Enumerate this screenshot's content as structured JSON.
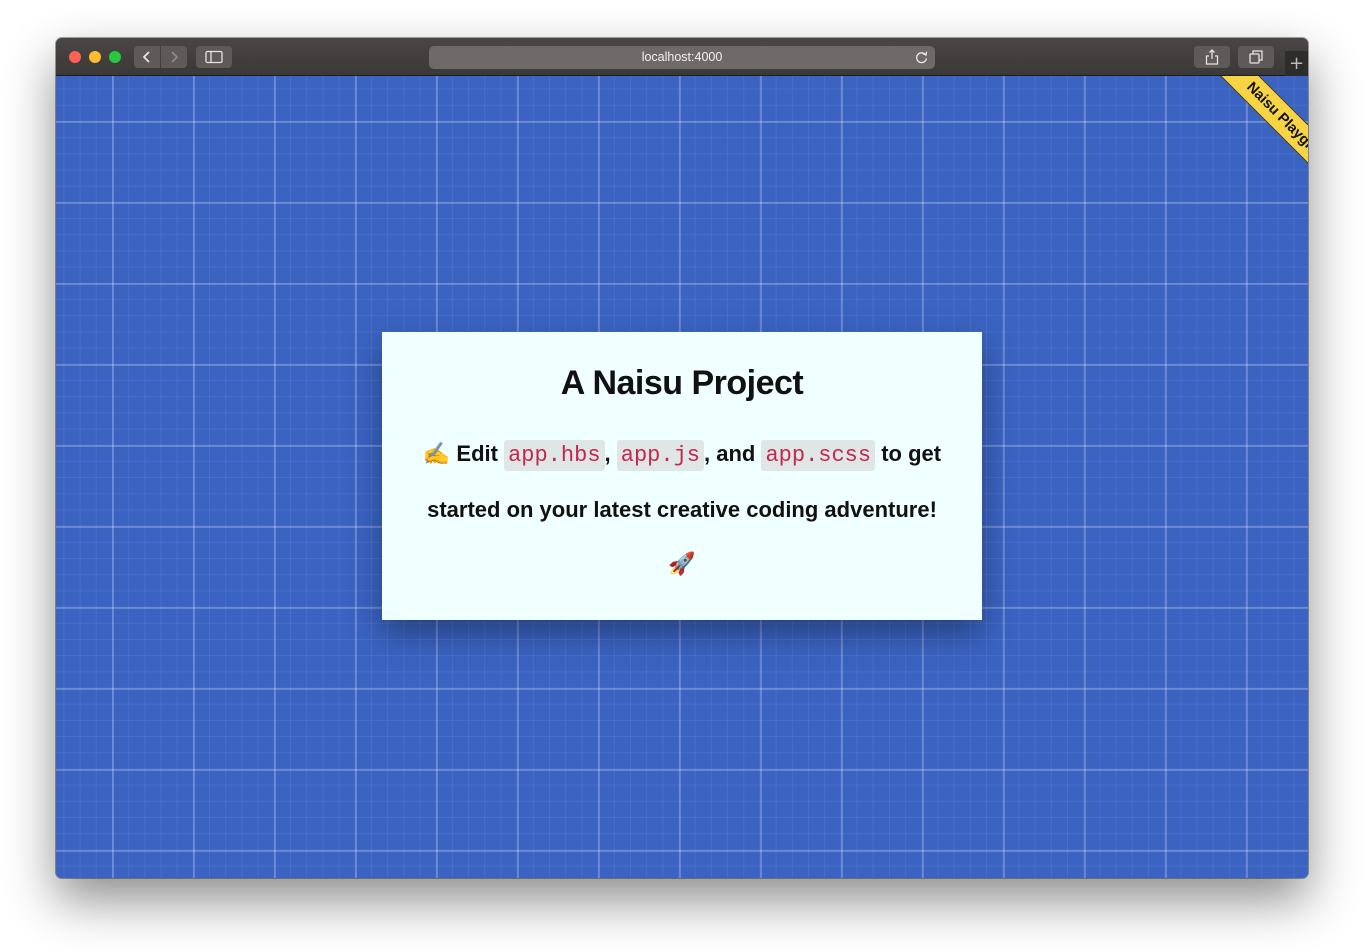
{
  "browser": {
    "url": "localhost:4000",
    "new_tab": "+"
  },
  "ribbon": {
    "label": "Naisu Playgr..."
  },
  "card": {
    "title": "A Naisu Project",
    "edit_emoji": "✍️",
    "edit_word": "Edit",
    "file1": "app.hbs",
    "sep1": ",",
    "file2": "app.js",
    "sep2": ", and",
    "file3": "app.scss",
    "rest": "to get started on your latest creative coding adventure!",
    "rocket": "🚀"
  },
  "colors": {
    "background": "#3a63c2",
    "card": "#f0ffff",
    "ribbon": "#f6d443",
    "code": "#c7254e"
  }
}
